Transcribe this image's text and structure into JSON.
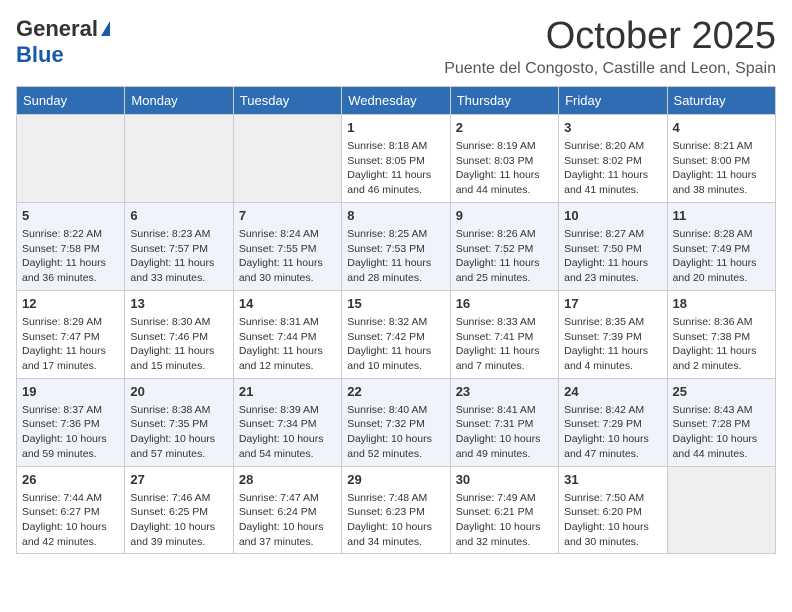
{
  "header": {
    "logo_general": "General",
    "logo_blue": "Blue",
    "month": "October 2025",
    "location": "Puente del Congosto, Castille and Leon, Spain"
  },
  "weekdays": [
    "Sunday",
    "Monday",
    "Tuesday",
    "Wednesday",
    "Thursday",
    "Friday",
    "Saturday"
  ],
  "weeks": [
    [
      {
        "day": "",
        "info": ""
      },
      {
        "day": "",
        "info": ""
      },
      {
        "day": "",
        "info": ""
      },
      {
        "day": "1",
        "info": "Sunrise: 8:18 AM\nSunset: 8:05 PM\nDaylight: 11 hours and 46 minutes."
      },
      {
        "day": "2",
        "info": "Sunrise: 8:19 AM\nSunset: 8:03 PM\nDaylight: 11 hours and 44 minutes."
      },
      {
        "day": "3",
        "info": "Sunrise: 8:20 AM\nSunset: 8:02 PM\nDaylight: 11 hours and 41 minutes."
      },
      {
        "day": "4",
        "info": "Sunrise: 8:21 AM\nSunset: 8:00 PM\nDaylight: 11 hours and 38 minutes."
      }
    ],
    [
      {
        "day": "5",
        "info": "Sunrise: 8:22 AM\nSunset: 7:58 PM\nDaylight: 11 hours and 36 minutes."
      },
      {
        "day": "6",
        "info": "Sunrise: 8:23 AM\nSunset: 7:57 PM\nDaylight: 11 hours and 33 minutes."
      },
      {
        "day": "7",
        "info": "Sunrise: 8:24 AM\nSunset: 7:55 PM\nDaylight: 11 hours and 30 minutes."
      },
      {
        "day": "8",
        "info": "Sunrise: 8:25 AM\nSunset: 7:53 PM\nDaylight: 11 hours and 28 minutes."
      },
      {
        "day": "9",
        "info": "Sunrise: 8:26 AM\nSunset: 7:52 PM\nDaylight: 11 hours and 25 minutes."
      },
      {
        "day": "10",
        "info": "Sunrise: 8:27 AM\nSunset: 7:50 PM\nDaylight: 11 hours and 23 minutes."
      },
      {
        "day": "11",
        "info": "Sunrise: 8:28 AM\nSunset: 7:49 PM\nDaylight: 11 hours and 20 minutes."
      }
    ],
    [
      {
        "day": "12",
        "info": "Sunrise: 8:29 AM\nSunset: 7:47 PM\nDaylight: 11 hours and 17 minutes."
      },
      {
        "day": "13",
        "info": "Sunrise: 8:30 AM\nSunset: 7:46 PM\nDaylight: 11 hours and 15 minutes."
      },
      {
        "day": "14",
        "info": "Sunrise: 8:31 AM\nSunset: 7:44 PM\nDaylight: 11 hours and 12 minutes."
      },
      {
        "day": "15",
        "info": "Sunrise: 8:32 AM\nSunset: 7:42 PM\nDaylight: 11 hours and 10 minutes."
      },
      {
        "day": "16",
        "info": "Sunrise: 8:33 AM\nSunset: 7:41 PM\nDaylight: 11 hours and 7 minutes."
      },
      {
        "day": "17",
        "info": "Sunrise: 8:35 AM\nSunset: 7:39 PM\nDaylight: 11 hours and 4 minutes."
      },
      {
        "day": "18",
        "info": "Sunrise: 8:36 AM\nSunset: 7:38 PM\nDaylight: 11 hours and 2 minutes."
      }
    ],
    [
      {
        "day": "19",
        "info": "Sunrise: 8:37 AM\nSunset: 7:36 PM\nDaylight: 10 hours and 59 minutes."
      },
      {
        "day": "20",
        "info": "Sunrise: 8:38 AM\nSunset: 7:35 PM\nDaylight: 10 hours and 57 minutes."
      },
      {
        "day": "21",
        "info": "Sunrise: 8:39 AM\nSunset: 7:34 PM\nDaylight: 10 hours and 54 minutes."
      },
      {
        "day": "22",
        "info": "Sunrise: 8:40 AM\nSunset: 7:32 PM\nDaylight: 10 hours and 52 minutes."
      },
      {
        "day": "23",
        "info": "Sunrise: 8:41 AM\nSunset: 7:31 PM\nDaylight: 10 hours and 49 minutes."
      },
      {
        "day": "24",
        "info": "Sunrise: 8:42 AM\nSunset: 7:29 PM\nDaylight: 10 hours and 47 minutes."
      },
      {
        "day": "25",
        "info": "Sunrise: 8:43 AM\nSunset: 7:28 PM\nDaylight: 10 hours and 44 minutes."
      }
    ],
    [
      {
        "day": "26",
        "info": "Sunrise: 7:44 AM\nSunset: 6:27 PM\nDaylight: 10 hours and 42 minutes."
      },
      {
        "day": "27",
        "info": "Sunrise: 7:46 AM\nSunset: 6:25 PM\nDaylight: 10 hours and 39 minutes."
      },
      {
        "day": "28",
        "info": "Sunrise: 7:47 AM\nSunset: 6:24 PM\nDaylight: 10 hours and 37 minutes."
      },
      {
        "day": "29",
        "info": "Sunrise: 7:48 AM\nSunset: 6:23 PM\nDaylight: 10 hours and 34 minutes."
      },
      {
        "day": "30",
        "info": "Sunrise: 7:49 AM\nSunset: 6:21 PM\nDaylight: 10 hours and 32 minutes."
      },
      {
        "day": "31",
        "info": "Sunrise: 7:50 AM\nSunset: 6:20 PM\nDaylight: 10 hours and 30 minutes."
      },
      {
        "day": "",
        "info": ""
      }
    ]
  ]
}
